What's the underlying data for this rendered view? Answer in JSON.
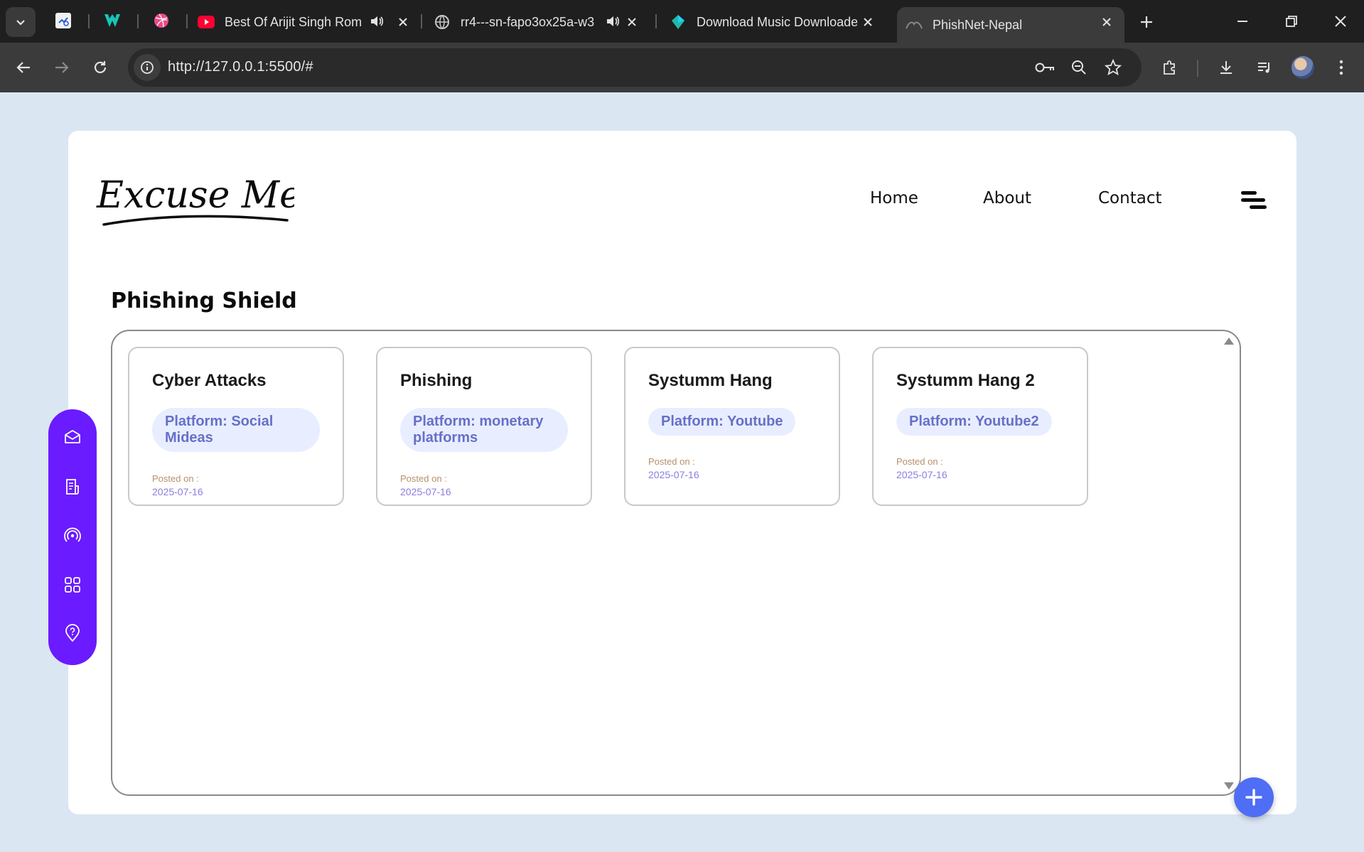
{
  "browser": {
    "tabs": [
      {
        "title": "Best Of Arijit Singh Rom",
        "favicon": "youtube-icon",
        "audio": true
      },
      {
        "title": "rr4---sn-fapo3ox25a-w3",
        "favicon": "globe-icon",
        "audio": true
      },
      {
        "title": "Download Music Downloade",
        "favicon": "diamond-icon",
        "audio": false
      },
      {
        "title": "PhishNet-Nepal",
        "favicon": "site-icon",
        "audio": false,
        "active": true
      }
    ],
    "url": "http://127.0.0.1:5500/#"
  },
  "site": {
    "logo_text": "Excuse Me!",
    "nav": [
      "Home",
      "About",
      "Contact"
    ]
  },
  "main": {
    "title": "Phishing Shield",
    "posts": [
      {
        "title": "Cyber Attacks",
        "platform": "Platform: Social Mideas",
        "posted_label": "Posted on :",
        "date": "2025-07-16"
      },
      {
        "title": "Phishing",
        "platform": "Platform: monetary platforms",
        "posted_label": "Posted on :",
        "date": "2025-07-16"
      },
      {
        "title": "Systumm Hang",
        "platform": "Platform: Youtube",
        "posted_label": "Posted on :",
        "date": "2025-07-16"
      },
      {
        "title": "Systumm Hang 2",
        "platform": "Platform: Youtube2",
        "posted_label": "Posted on :",
        "date": "2025-07-16"
      }
    ]
  },
  "sidebar": {
    "icons": [
      "mail-icon",
      "document-icon",
      "broadcast-icon",
      "grid-icon",
      "location-icon"
    ]
  },
  "colors": {
    "accent": "#6a1bff",
    "fab": "#4f6ef5",
    "page_bg": "#dbe6f3"
  }
}
